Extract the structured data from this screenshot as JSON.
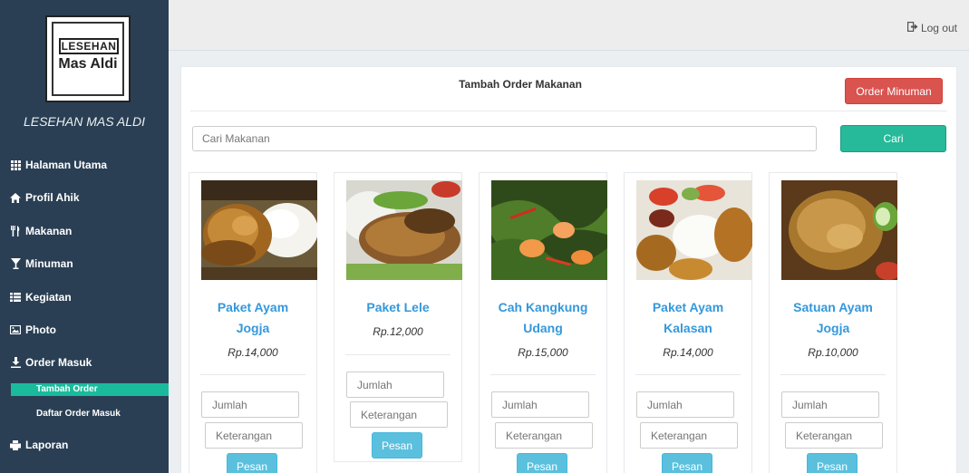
{
  "sidebar": {
    "logo": {
      "line1": "LESEHAN",
      "line2": "Mas Aldi"
    },
    "brand": "LESEHAN MAS ALDI",
    "items": [
      {
        "label": "Halaman Utama",
        "icon": "grid-icon"
      },
      {
        "label": "Profil Ahik",
        "icon": "home-icon"
      },
      {
        "label": "Makanan",
        "icon": "cutlery-icon"
      },
      {
        "label": "Minuman",
        "icon": "glass-icon"
      },
      {
        "label": "Kegiatan",
        "icon": "list-icon"
      },
      {
        "label": "Photo",
        "icon": "picture-icon"
      },
      {
        "label": "Order Masuk",
        "icon": "download-icon"
      },
      {
        "label": "Laporan",
        "icon": "print-icon"
      }
    ],
    "subitems": [
      {
        "label": "Tambah Order",
        "active": true
      },
      {
        "label": "Daftar Order Masuk",
        "active": false
      }
    ]
  },
  "topbar": {
    "logout": "Log out",
    "logout_icon": "sign-out-icon"
  },
  "panel": {
    "title": "Tambah Order Makanan",
    "order_minuman_label": "Order Minuman",
    "search_placeholder": "Cari Makanan",
    "search_button": "Cari"
  },
  "products": [
    {
      "name_lines": [
        "Paket Ayam",
        "Jogja"
      ],
      "price": "Rp.14,000",
      "qty_placeholder": "Jumlah",
      "note_placeholder": "Keterangan",
      "button": "Pesan"
    },
    {
      "name_lines": [
        "Paket Lele"
      ],
      "price": "Rp.12,000",
      "qty_placeholder": "Jumlah",
      "note_placeholder": "Keterangan",
      "button": "Pesan"
    },
    {
      "name_lines": [
        "Cah Kangkung",
        "Udang"
      ],
      "price": "Rp.15,000",
      "qty_placeholder": "Jumlah",
      "note_placeholder": "Keterangan",
      "button": "Pesan"
    },
    {
      "name_lines": [
        "Paket Ayam",
        "Kalasan"
      ],
      "price": "Rp.14,000",
      "qty_placeholder": "Jumlah",
      "note_placeholder": "Keterangan",
      "button": "Pesan"
    },
    {
      "name_lines": [
        "Satuan Ayam",
        "Jogja"
      ],
      "price": "Rp.10,000",
      "qty_placeholder": "Jumlah",
      "note_placeholder": "Keterangan",
      "button": "Pesan"
    }
  ],
  "colors": {
    "sidebar": "#2a3f54",
    "accent": "#1abb9c",
    "danger": "#d9534f",
    "success": "#26b99a",
    "info": "#5bc0de",
    "link": "#3498db"
  }
}
